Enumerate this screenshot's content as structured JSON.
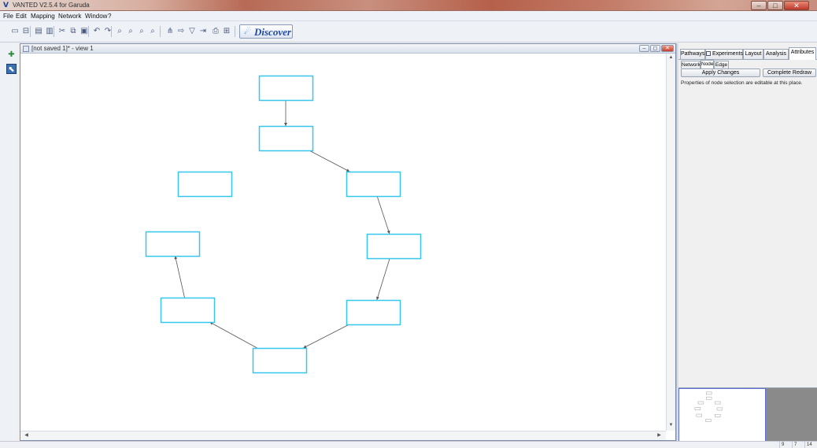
{
  "window": {
    "title": "VANTED V2.5.4 for Garuda",
    "logo": "V",
    "controls": [
      "minimize",
      "maximize",
      "close"
    ]
  },
  "menu": [
    {
      "label": "File"
    },
    {
      "label": "Edit"
    },
    {
      "label": "Mapping"
    },
    {
      "label": "Network"
    },
    {
      "label": "Window"
    },
    {
      "label": "?"
    }
  ],
  "toolbar": {
    "icons": [
      {
        "name": "new-graph-icon",
        "glyph": "▭"
      },
      {
        "name": "open-icon",
        "glyph": "⊟"
      },
      {
        "name": "save-icon",
        "glyph": "▤"
      },
      {
        "name": "save-as-icon",
        "glyph": "▥"
      },
      {
        "name": "cut-icon",
        "glyph": "✂"
      },
      {
        "name": "copy-icon",
        "glyph": "⧉"
      },
      {
        "name": "paste-icon",
        "glyph": "▣"
      },
      {
        "name": "undo-icon",
        "glyph": "↶"
      },
      {
        "name": "redo-icon",
        "glyph": "↷"
      },
      {
        "name": "zoom-icon",
        "glyph": "⌕"
      },
      {
        "name": "zoom-in-icon",
        "glyph": "⌕"
      },
      {
        "name": "zoom-out-icon",
        "glyph": "⌕"
      },
      {
        "name": "zoom-fit-icon",
        "glyph": "⌕"
      },
      {
        "name": "layout-icon",
        "glyph": "⋔"
      },
      {
        "name": "move-icon",
        "glyph": "⇨"
      },
      {
        "name": "filter-icon",
        "glyph": "▽"
      },
      {
        "name": "export-icon",
        "glyph": "⇥"
      },
      {
        "name": "print-icon",
        "glyph": "⎙"
      },
      {
        "name": "settings-icon",
        "glyph": "⊞"
      }
    ],
    "discover_label": "Discover"
  },
  "left_tools": [
    {
      "name": "node-tool-icon",
      "glyph": "✚"
    },
    {
      "name": "select-tool-icon",
      "glyph": "⬉"
    }
  ],
  "frame": {
    "title": "[not saved 1]* - view 1"
  },
  "graph": {
    "node_color": "#36c6ee",
    "edge_color": "#555555",
    "nodes": [
      {
        "id": "n1",
        "label": ""
      },
      {
        "id": "n2",
        "label": ""
      },
      {
        "id": "n3",
        "label": ""
      },
      {
        "id": "n4",
        "label": ""
      },
      {
        "id": "n5",
        "label": ""
      },
      {
        "id": "n6",
        "label": ""
      },
      {
        "id": "n7",
        "label": ""
      },
      {
        "id": "n8",
        "label": ""
      },
      {
        "id": "n9",
        "label": ""
      }
    ],
    "edges": [
      {
        "from": "n1",
        "to": "n2"
      },
      {
        "from": "n2",
        "to": "n3"
      },
      {
        "from": "n3",
        "to": "n4"
      },
      {
        "from": "n4",
        "to": "n5"
      },
      {
        "from": "n5",
        "to": "n6"
      },
      {
        "from": "n6",
        "to": "n7"
      },
      {
        "from": "n7",
        "to": "n8"
      }
    ]
  },
  "panel": {
    "tabs": [
      {
        "label": "Pathways",
        "active": false
      },
      {
        "label": "Experiments",
        "active": false
      },
      {
        "label": "Layout",
        "active": false
      },
      {
        "label": "Analysis",
        "active": false
      },
      {
        "label": "Attributes",
        "active": true
      }
    ],
    "subtabs": [
      {
        "label": "Network",
        "active": false
      },
      {
        "label": "Node",
        "active": true
      },
      {
        "label": "Edge",
        "active": false
      }
    ],
    "apply_label": "Apply Changes",
    "redraw_label": "Complete Redraw",
    "info": "Properties of node selection are editable at this place."
  },
  "status": {
    "cells": [
      "9",
      "7",
      "14"
    ]
  }
}
